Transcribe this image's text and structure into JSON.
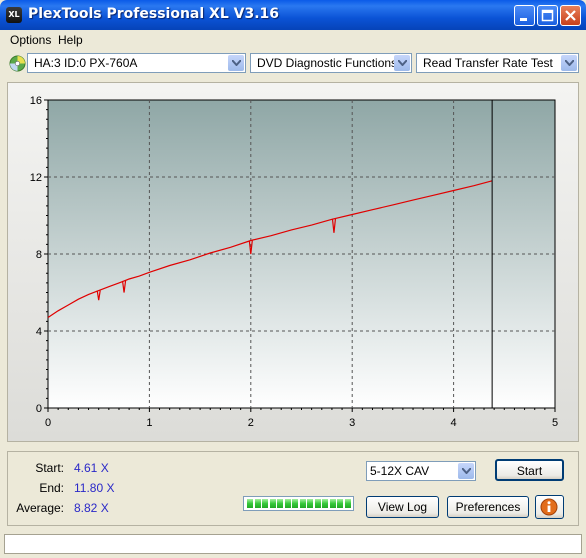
{
  "window": {
    "title": "PlexTools Professional XL V3.16",
    "app_icon_text": "XL"
  },
  "menu": {
    "items": [
      "Options",
      "Help"
    ]
  },
  "toolbar": {
    "drive": "HA:3 ID:0  PX-760A",
    "function": "DVD Diagnostic Functions",
    "test": "Read Transfer Rate Test"
  },
  "chart_data": {
    "type": "line",
    "xlim": [
      0,
      5
    ],
    "ylim": [
      0,
      16
    ],
    "x_ticks": [
      "0",
      "1",
      "2",
      "3",
      "4",
      "5"
    ],
    "y_ticks": [
      "0",
      "4",
      "8",
      "12",
      "16"
    ],
    "grid": true,
    "end_marker_x": 4.38,
    "series": [
      {
        "color": "#e00000",
        "x": [
          0,
          0.1,
          0.2,
          0.3,
          0.4,
          0.5,
          0.6,
          0.7,
          0.8,
          0.9,
          1.0,
          1.2,
          1.4,
          1.6,
          1.8,
          2.0,
          2.2,
          2.4,
          2.6,
          2.8,
          3.0,
          3.2,
          3.4,
          3.6,
          3.8,
          4.0,
          4.2,
          4.38
        ],
        "values": [
          4.7,
          5.05,
          5.35,
          5.65,
          5.9,
          6.1,
          6.3,
          6.5,
          6.7,
          6.85,
          7.05,
          7.4,
          7.7,
          8.05,
          8.35,
          8.7,
          8.95,
          9.25,
          9.5,
          9.8,
          10.05,
          10.3,
          10.55,
          10.8,
          11.05,
          11.3,
          11.55,
          11.8
        ]
      }
    ],
    "dips": [
      {
        "x": 0.5,
        "to": 5.6
      },
      {
        "x": 0.75,
        "to": 6.0
      },
      {
        "x": 2.0,
        "to": 8.0
      },
      {
        "x": 2.82,
        "to": 9.1
      }
    ]
  },
  "stats": {
    "start_label": "Start:",
    "start_value": "4.61 X",
    "end_label": "End:",
    "end_value": "11.80 X",
    "average_label": "Average:",
    "average_value": "8.82 X"
  },
  "controls": {
    "speed": "5-12X CAV",
    "start": "Start",
    "view_log": "View Log",
    "preferences": "Preferences",
    "progress_segments": 14
  },
  "status": {
    "text": ""
  }
}
